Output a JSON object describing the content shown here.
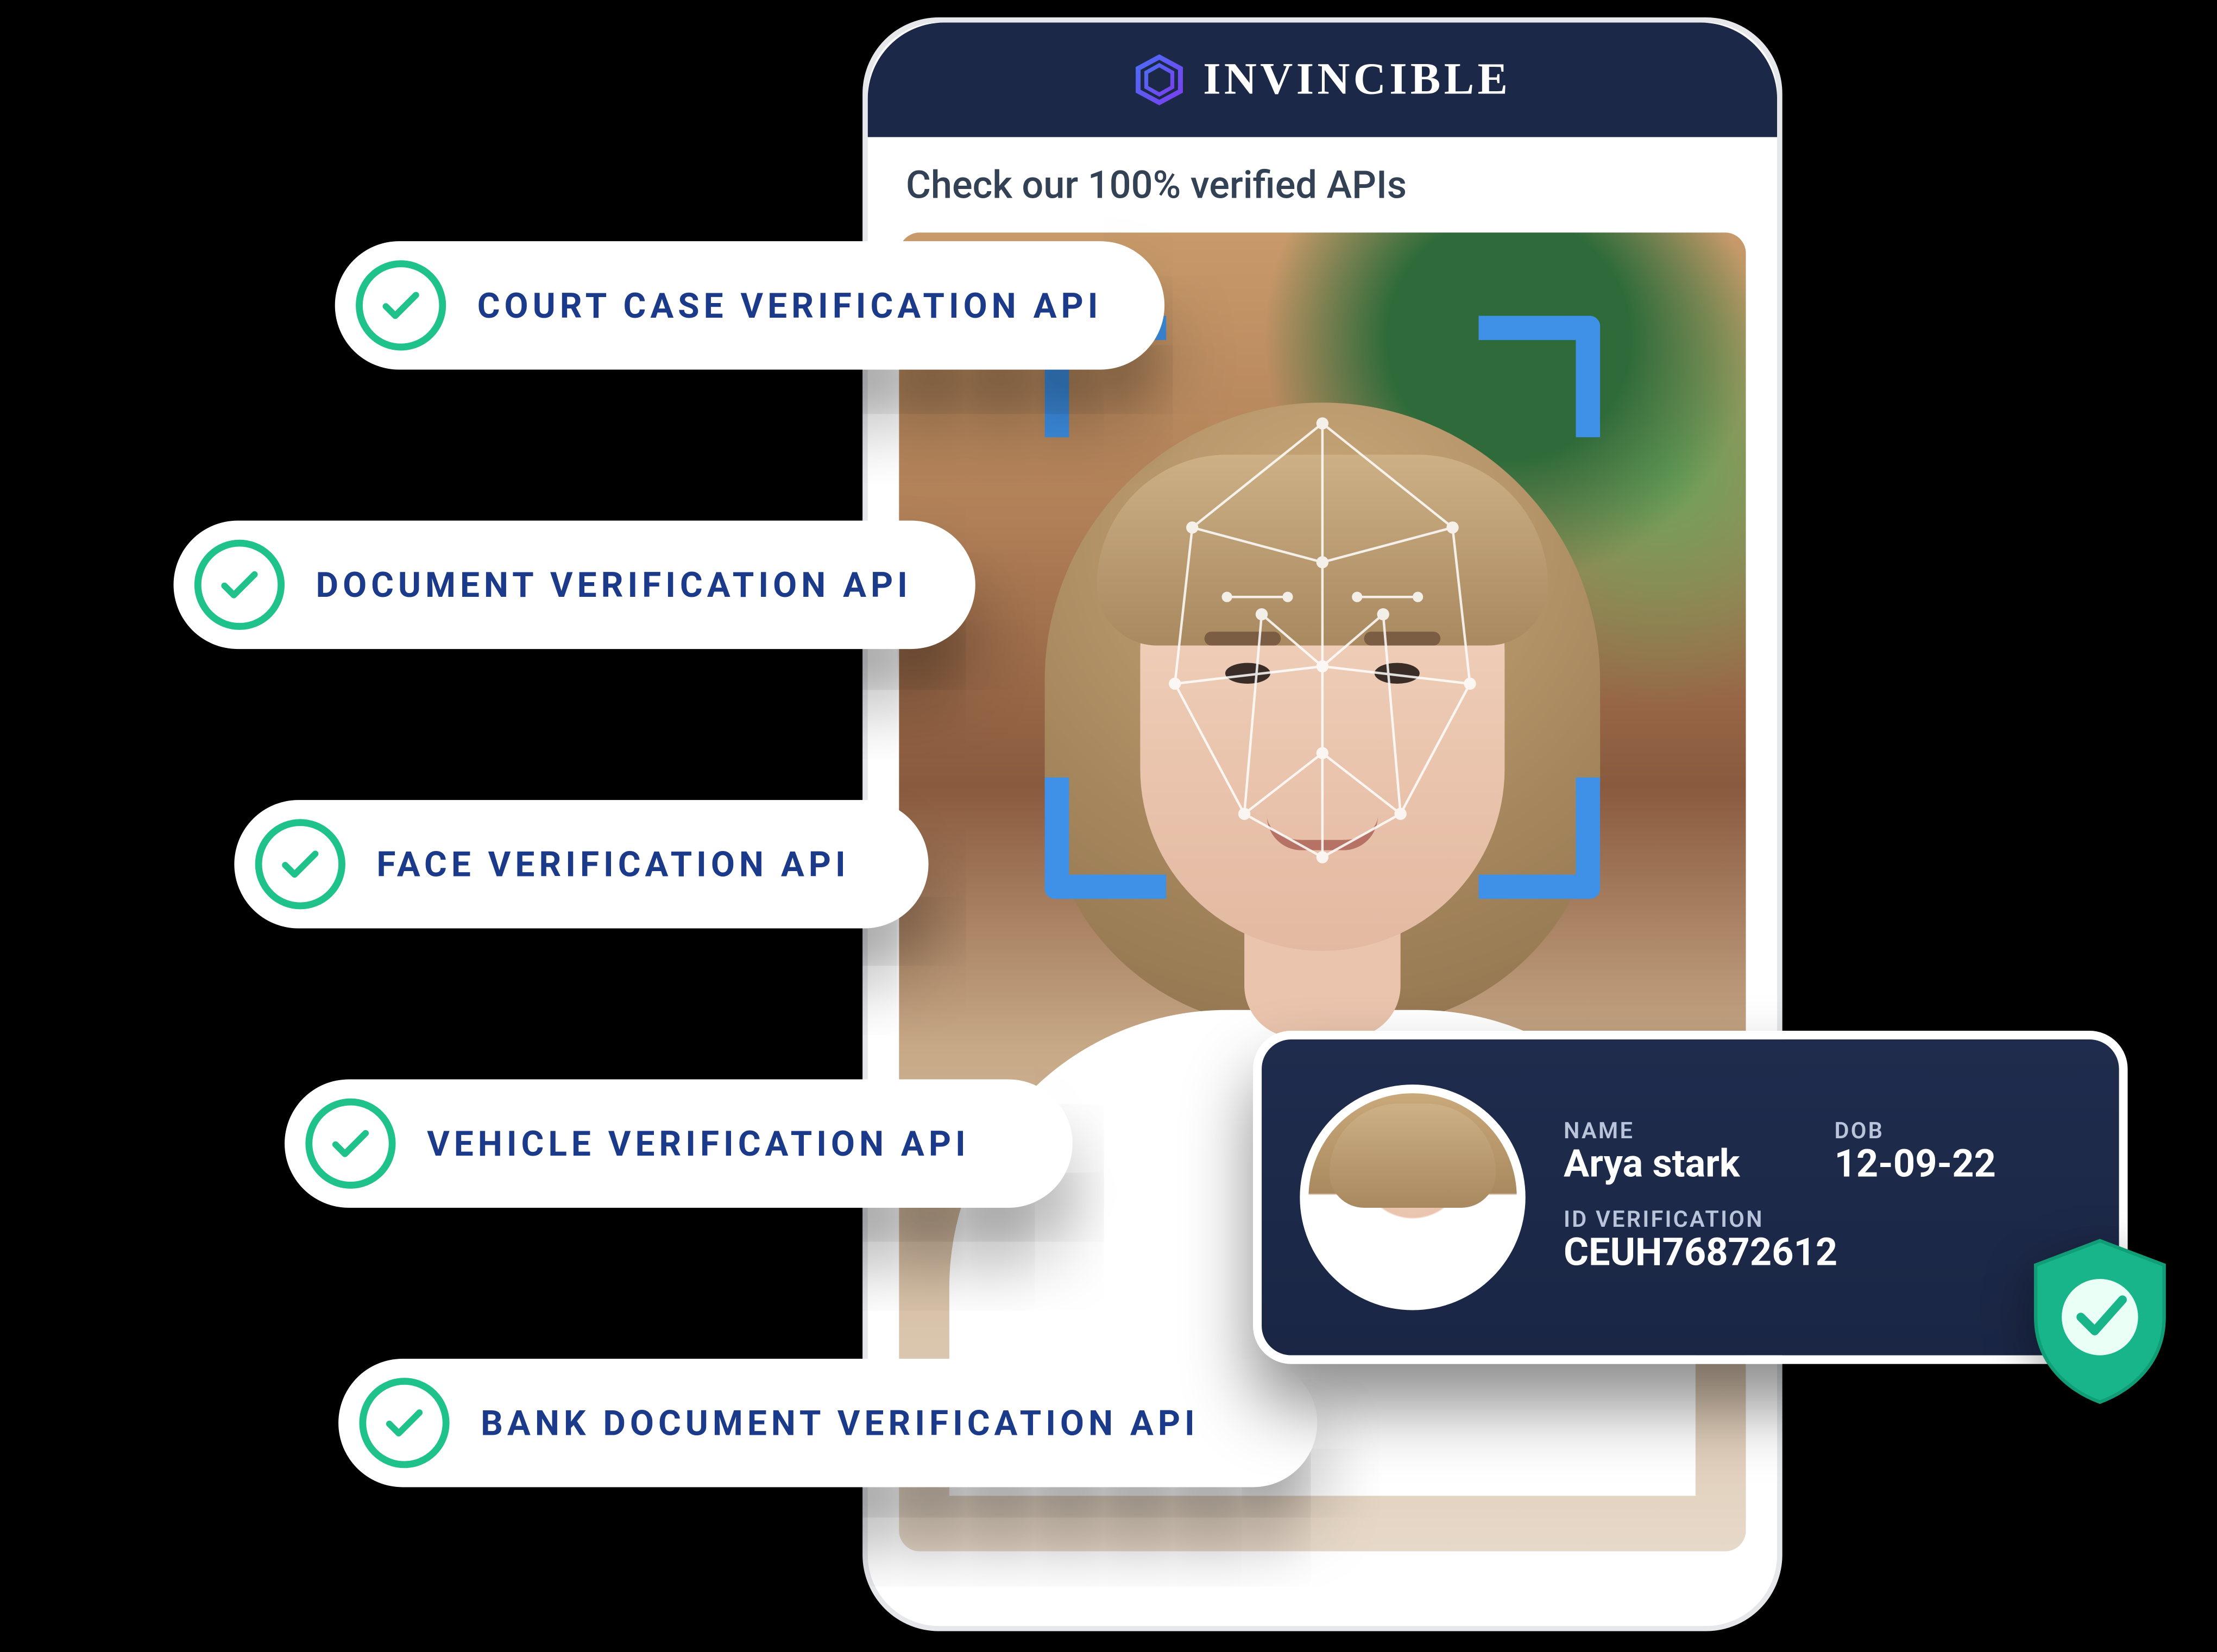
{
  "brand": {
    "name": "INVINCIBLE"
  },
  "caption": "Check our 100% verified APIs",
  "api_pills": [
    {
      "label": "COURT CASE VERIFICATION API"
    },
    {
      "label": "DOCUMENT VERIFICATION API"
    },
    {
      "label": "FACE VERIFICATION API"
    },
    {
      "label": "VEHICLE VERIFICATION API"
    },
    {
      "label": "BANK DOCUMENT VERIFICATION API"
    }
  ],
  "id_card": {
    "name_label": "NAME",
    "name_value": "Arya stark",
    "dob_label": "DOB",
    "dob_value": "12-09-22",
    "idv_label": "ID VERIFICATION",
    "idv_value": "CEUH76872612"
  },
  "colors": {
    "navy": "#1c2847",
    "blue_text": "#1b3a8a",
    "scan_blue": "#3e91e6",
    "green": "#17b589"
  }
}
